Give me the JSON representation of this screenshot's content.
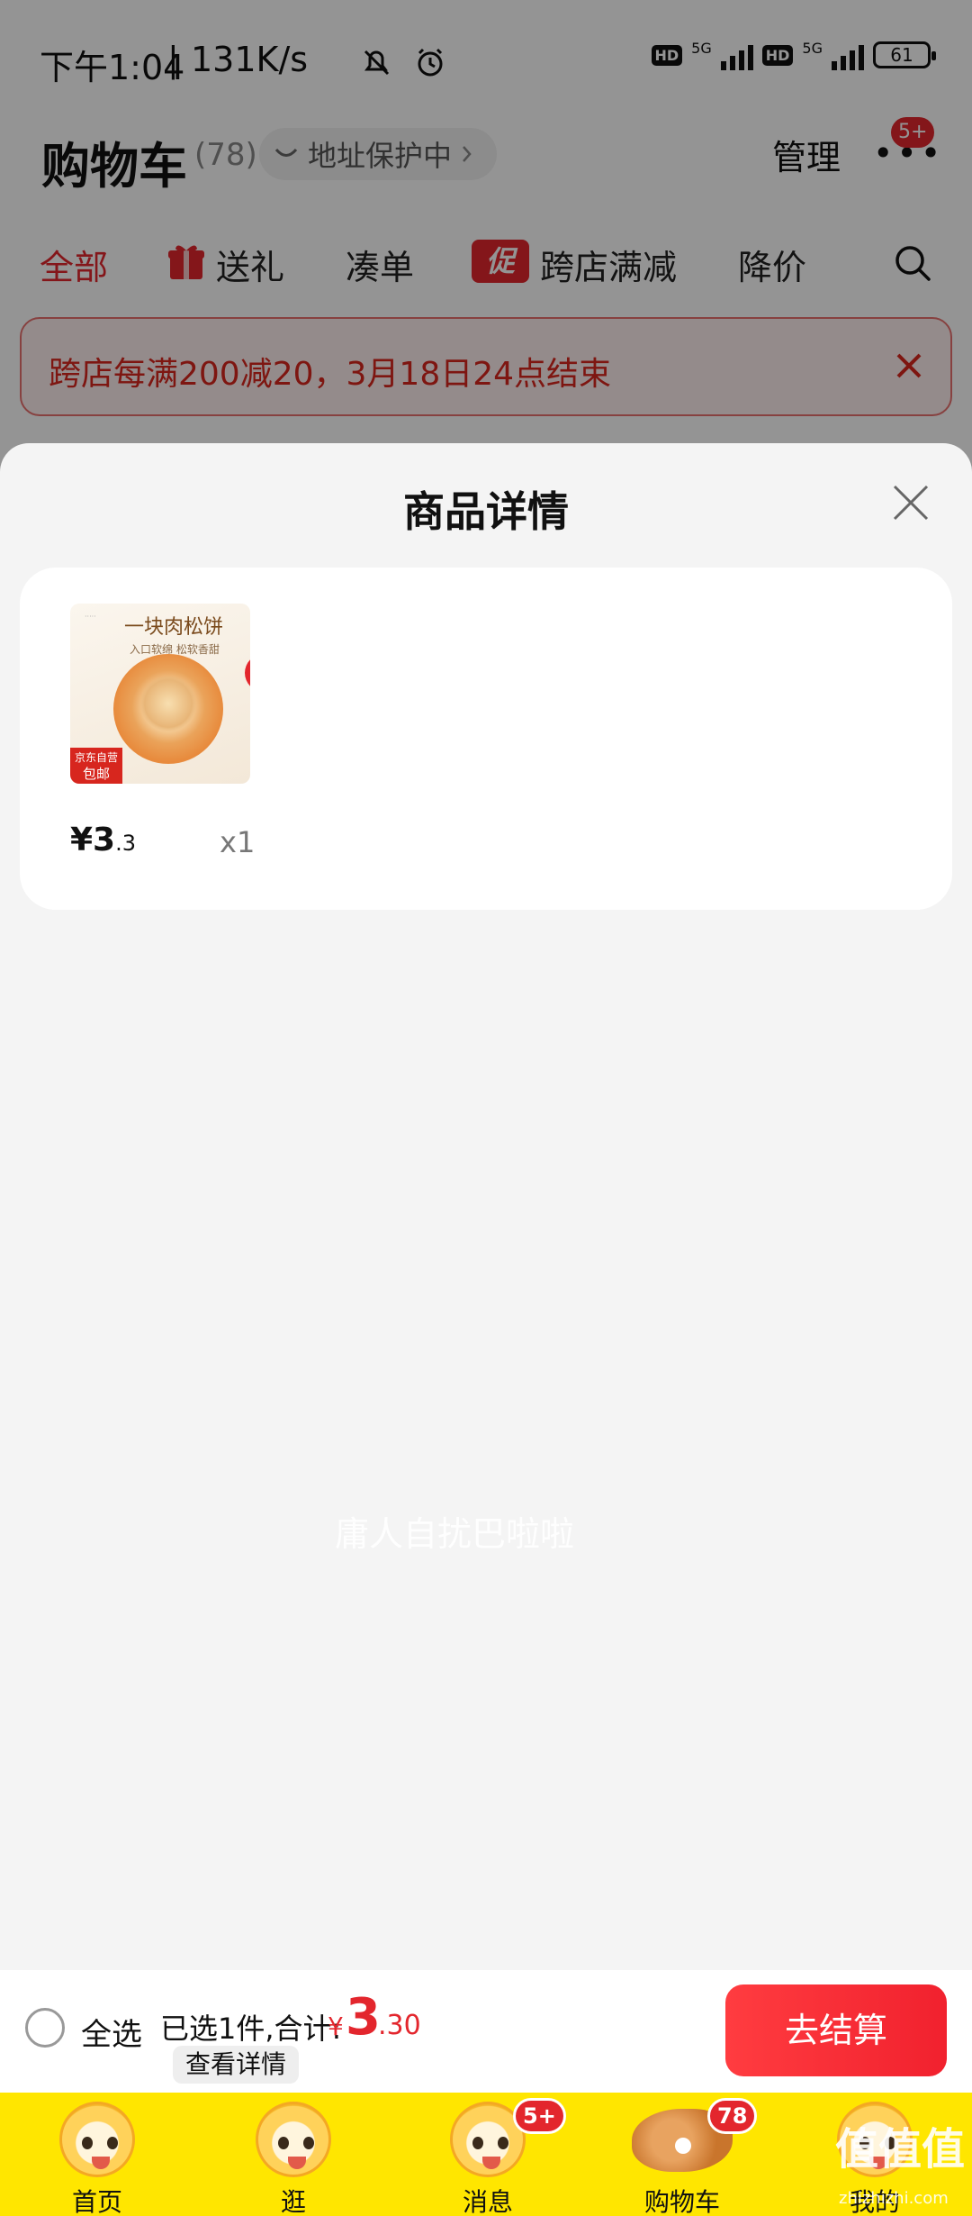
{
  "status_bar": {
    "time": "下午1:04",
    "speed": "131K/s",
    "hd1": "HD",
    "net1": "5G",
    "hd2": "HD",
    "net2": "5G",
    "battery": "61"
  },
  "header": {
    "title": "购物车",
    "count": "(78)",
    "address_status": "地址保护中",
    "manage_label": "管理",
    "more_badge": "5+"
  },
  "tabs": [
    {
      "label": "全部",
      "active": true
    },
    {
      "label": "送礼",
      "icon": "gift-icon"
    },
    {
      "label": "凑单"
    },
    {
      "label": "跨店满减",
      "chip": "促"
    },
    {
      "label": "降价"
    }
  ],
  "promo_banner": {
    "text": "跨店每满200减20，3月18日24点结束"
  },
  "sheet": {
    "title": "商品详情",
    "product": {
      "thumb_title": "一块肉松饼",
      "thumb_sub": "入口软绵 松软香甜",
      "thumb_badge_line1": "京东自营",
      "thumb_badge_line2": "包邮",
      "price_int": "¥3",
      "price_dec": ".3",
      "qty": "x1"
    }
  },
  "watermark_text": "庸人自扰巴啦啦",
  "action_bar": {
    "select_all": "全选",
    "summary": "已选1件,合计:",
    "currency": "¥",
    "total_int": "3",
    "total_dec": ".30",
    "detail_button": "查看详情",
    "checkout_button": "去结算"
  },
  "tab_bar": [
    {
      "label": "首页",
      "icon": "home-mascot-icon"
    },
    {
      "label": "逛",
      "icon": "browse-mascot-icon"
    },
    {
      "label": "消息",
      "icon": "message-mascot-icon",
      "badge": "5+"
    },
    {
      "label": "购物车",
      "icon": "cart-taiyaki-icon",
      "badge": "78"
    },
    {
      "label": "我的",
      "icon": "profile-mascot-icon"
    }
  ],
  "corner_watermark": {
    "main": "值值值",
    "sub": "zhizhizhi.com"
  },
  "colors": {
    "accent_red": "#e3262d",
    "tabbar_yellow": "#ffe600"
  }
}
